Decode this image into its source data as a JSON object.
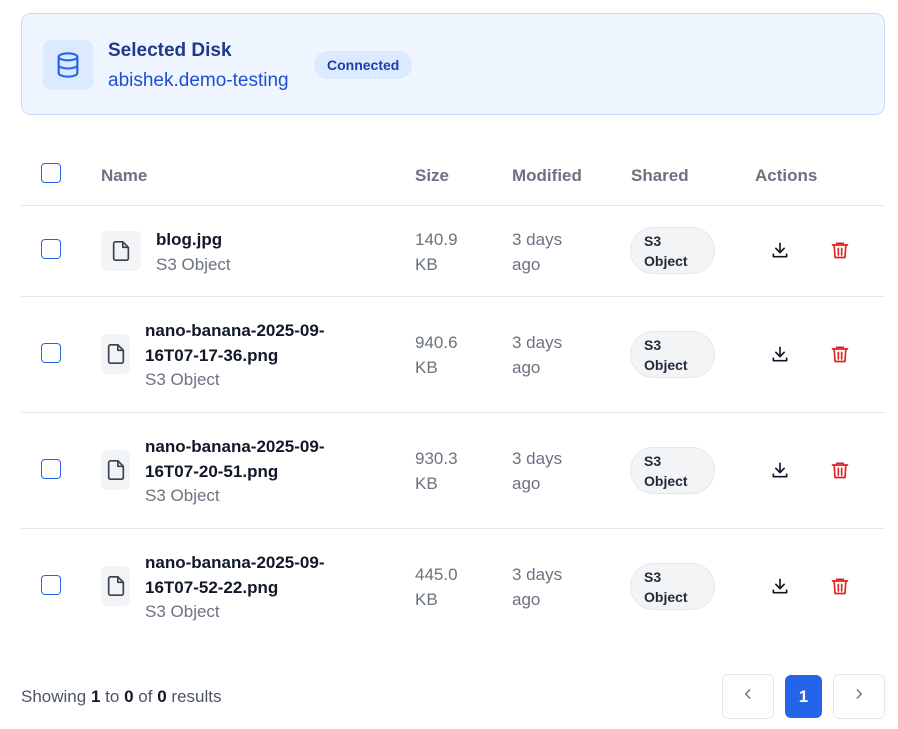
{
  "disk": {
    "title": "Selected Disk",
    "name": "abishek.demo-testing",
    "status": "Connected",
    "icon": "database-icon"
  },
  "table": {
    "columns": {
      "name": "Name",
      "size": "Size",
      "modified": "Modified",
      "shared": "Shared",
      "actions": "Actions"
    },
    "rows": [
      {
        "name_line1": "blog.jpg",
        "name_line2": "",
        "type": "S3 Object",
        "size_line1": "140.9",
        "size_line2": "KB",
        "modified_line1": "3 days",
        "modified_line2": "ago",
        "shared_line1": "S3",
        "shared_line2": "Object"
      },
      {
        "name_line1": "nano-banana-2025-09-",
        "name_line2": "16T07-17-36.png",
        "type": "S3 Object",
        "size_line1": "940.6",
        "size_line2": "KB",
        "modified_line1": "3 days",
        "modified_line2": "ago",
        "shared_line1": "S3",
        "shared_line2": "Object"
      },
      {
        "name_line1": "nano-banana-2025-09-",
        "name_line2": "16T07-20-51.png",
        "type": "S3 Object",
        "size_line1": "930.3",
        "size_line2": "KB",
        "modified_line1": "3 days",
        "modified_line2": "ago",
        "shared_line1": "S3",
        "shared_line2": "Object"
      },
      {
        "name_line1": "nano-banana-2025-09-",
        "name_line2": "16T07-52-22.png",
        "type": "S3 Object",
        "size_line1": "445.0",
        "size_line2": "KB",
        "modified_line1": "3 days",
        "modified_line2": "ago",
        "shared_line1": "S3",
        "shared_line2": "Object"
      }
    ]
  },
  "pagination": {
    "showing_prefix": "Showing",
    "from": "1",
    "to_word": "to",
    "to": "0",
    "of_word": "of",
    "total": "0",
    "results_word": "results",
    "current_page": "1"
  },
  "colors": {
    "accent": "#2563eb",
    "danger": "#dc2626",
    "card_bg": "#eff6ff"
  }
}
